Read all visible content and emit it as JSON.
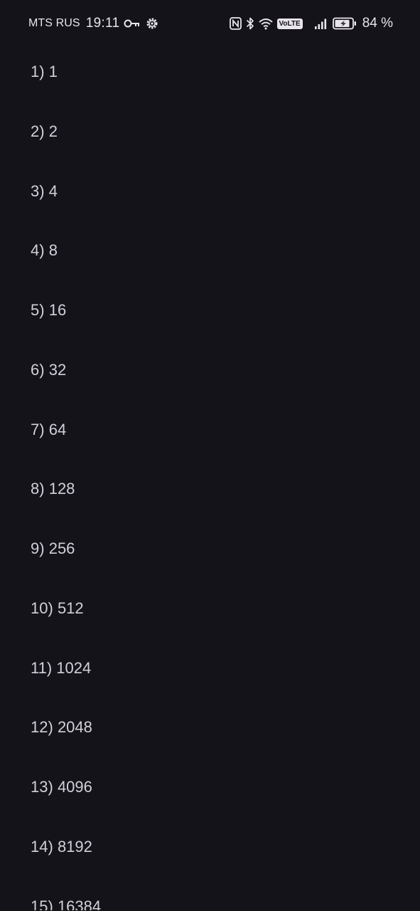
{
  "status_bar": {
    "carrier": "MTS RUS",
    "time": "19:11",
    "volte_label": "VoLTE",
    "battery_percent": "84 %",
    "icons": [
      "key-icon",
      "settings-gear-icon",
      "nfc-icon",
      "bluetooth-icon",
      "wifi-icon",
      "volte-icon",
      "signal-icon",
      "battery-charging-icon"
    ],
    "text_color": "#e8e6ea"
  },
  "list": {
    "items": [
      {
        "index": "1",
        "value": "1"
      },
      {
        "index": "2",
        "value": "2"
      },
      {
        "index": "3",
        "value": "4"
      },
      {
        "index": "4",
        "value": "8"
      },
      {
        "index": "5",
        "value": "16"
      },
      {
        "index": "6",
        "value": "32"
      },
      {
        "index": "7",
        "value": "64"
      },
      {
        "index": "8",
        "value": "128"
      },
      {
        "index": "9",
        "value": "256"
      },
      {
        "index": "10",
        "value": "512"
      },
      {
        "index": "11",
        "value": "1024"
      },
      {
        "index": "12",
        "value": "2048"
      },
      {
        "index": "13",
        "value": "4096"
      },
      {
        "index": "14",
        "value": "8192"
      },
      {
        "index": "15",
        "value": "16384"
      }
    ]
  },
  "theme": {
    "background": "#15131a",
    "text": "#d3d0d8"
  }
}
